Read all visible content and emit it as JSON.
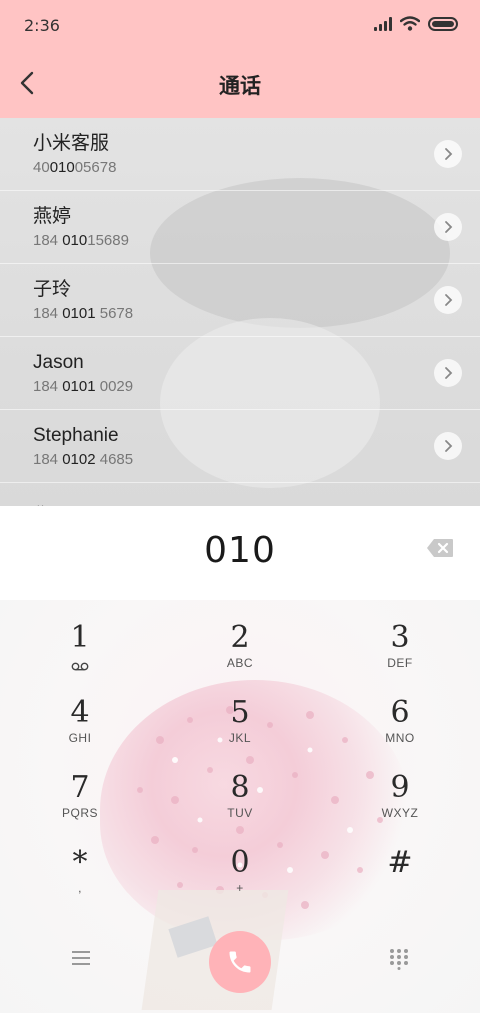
{
  "status_bar": {
    "time": "2:36"
  },
  "header": {
    "title": "通话"
  },
  "contacts": [
    {
      "name": "小米客服",
      "number_pre": "40",
      "number_match": "010",
      "number_post": "05678"
    },
    {
      "name": "燕婷",
      "number_pre": "184 ",
      "number_match": "010",
      "number_post": "15689"
    },
    {
      "name": "子玲",
      "number_pre": "184 ",
      "number_match": "0101",
      "number_post": " 5678"
    },
    {
      "name": "Jason",
      "number_pre": "184 ",
      "number_match": "0101",
      "number_post": " 0029"
    },
    {
      "name": "Stephanie",
      "number_pre": "184 ",
      "number_match": "0102",
      "number_post": " 4685"
    }
  ],
  "partial_contact": "燕雨",
  "dialer": {
    "entered_number": "010"
  },
  "keys": [
    {
      "digit": "1",
      "letters": ""
    },
    {
      "digit": "2",
      "letters": "ABC"
    },
    {
      "digit": "3",
      "letters": "DEF"
    },
    {
      "digit": "4",
      "letters": "GHI"
    },
    {
      "digit": "5",
      "letters": "JKL"
    },
    {
      "digit": "6",
      "letters": "MNO"
    },
    {
      "digit": "7",
      "letters": "PQRS"
    },
    {
      "digit": "8",
      "letters": "TUV"
    },
    {
      "digit": "9",
      "letters": "WXYZ"
    },
    {
      "digit": "*",
      "letters": ","
    },
    {
      "digit": "0",
      "letters": "+"
    },
    {
      "digit": "#",
      "letters": ""
    }
  ],
  "colors": {
    "header_bg": "#ffc4c4",
    "call_button": "#ffb3b8"
  },
  "icons": {
    "back": "back-arrow-icon",
    "backspace": "backspace-icon",
    "menu": "menu-icon",
    "call": "phone-icon",
    "keypad_toggle": "dialpad-icon"
  }
}
